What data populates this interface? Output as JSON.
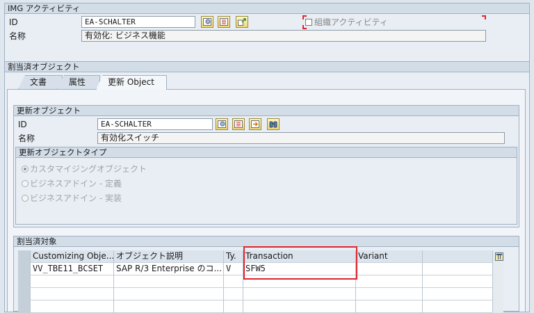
{
  "img_activity": {
    "title": "IMG アクティビティ",
    "id_label": "ID",
    "id_value": "EA-SCHALTER",
    "name_label": "名称",
    "name_value": "有効化: ビジネス機能",
    "org_checkbox_label": "組織アクティビティ"
  },
  "assigned_objects": {
    "title": "割当済オブジェクト",
    "tabs": [
      {
        "label": "文書"
      },
      {
        "label": "属性"
      },
      {
        "label": "更新 Object"
      }
    ]
  },
  "update_object": {
    "title": "更新オブジェクト",
    "id_label": "ID",
    "id_value": "EA-SCHALTER",
    "name_label": "名称",
    "name_value": "有効化スイッチ",
    "type_group_title": "更新オブジェクトタイプ",
    "types": [
      {
        "label": "カスタマイジングオブジェクト",
        "selected": true
      },
      {
        "label": "ビジネスアドイン - 定義",
        "selected": false
      },
      {
        "label": "ビジネスアドイン - 実装",
        "selected": false
      }
    ]
  },
  "assigned_targets": {
    "title": "割当済対象",
    "columns": [
      "Customizing Obje...",
      "オブジェクト説明",
      "Ty.",
      "Transaction",
      "Variant"
    ],
    "rows": [
      [
        "VV_TBE11_BCSET",
        "SAP R/3 Enterprise のコ...",
        "V",
        "SFW5",
        ""
      ]
    ]
  },
  "icons": {
    "display": "display-icon",
    "list": "list-icon",
    "navigate": "navigate-icon",
    "search": "binoculars-icon",
    "table_settings": "table-settings-icon"
  },
  "colors": {
    "highlight": "#e0242c",
    "group_header": "#d3dde8"
  }
}
